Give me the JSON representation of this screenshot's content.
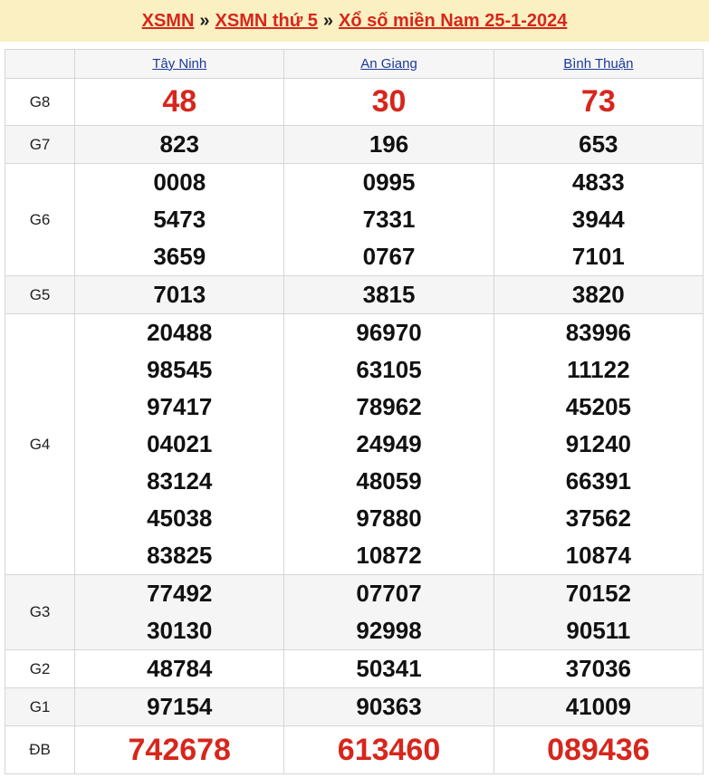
{
  "breadcrumb": {
    "home": "XSMN",
    "separator": "»",
    "day": "XSMN thứ 5",
    "current": "Xổ số miền Nam 25-1-2024"
  },
  "provinces": [
    "Tây Ninh",
    "An Giang",
    "Bình Thuận"
  ],
  "prizes": [
    {
      "label": "G8",
      "values": [
        [
          "48"
        ],
        [
          "30"
        ],
        [
          "73"
        ]
      ]
    },
    {
      "label": "G7",
      "values": [
        [
          "823"
        ],
        [
          "196"
        ],
        [
          "653"
        ]
      ]
    },
    {
      "label": "G6",
      "values": [
        [
          "0008",
          "5473",
          "3659"
        ],
        [
          "0995",
          "7331",
          "0767"
        ],
        [
          "4833",
          "3944",
          "7101"
        ]
      ]
    },
    {
      "label": "G5",
      "values": [
        [
          "7013"
        ],
        [
          "3815"
        ],
        [
          "3820"
        ]
      ]
    },
    {
      "label": "G4",
      "values": [
        [
          "20488",
          "98545",
          "97417",
          "04021",
          "83124",
          "45038",
          "83825"
        ],
        [
          "96970",
          "63105",
          "78962",
          "24949",
          "48059",
          "97880",
          "10872"
        ],
        [
          "83996",
          "11122",
          "45205",
          "91240",
          "66391",
          "37562",
          "10874"
        ]
      ]
    },
    {
      "label": "G3",
      "values": [
        [
          "77492",
          "30130"
        ],
        [
          "07707",
          "92998"
        ],
        [
          "70152",
          "90511"
        ]
      ]
    },
    {
      "label": "G2",
      "values": [
        [
          "48784"
        ],
        [
          "50341"
        ],
        [
          "37036"
        ]
      ]
    },
    {
      "label": "G1",
      "values": [
        [
          "97154"
        ],
        [
          "90363"
        ],
        [
          "41009"
        ]
      ]
    },
    {
      "label": "ĐB",
      "values": [
        [
          "742678"
        ],
        [
          "613460"
        ],
        [
          "089436"
        ]
      ]
    }
  ],
  "colors": {
    "accent_red": "#d7261c",
    "link_blue": "#1a3a9a",
    "header_bg": "#fbf0c1"
  }
}
